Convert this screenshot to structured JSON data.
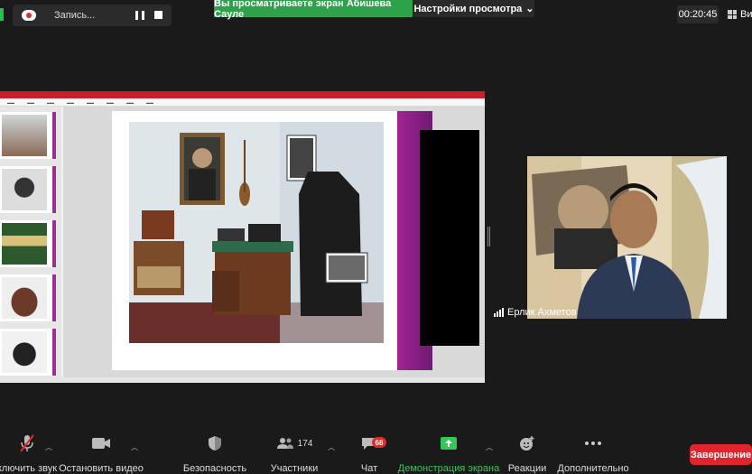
{
  "colors": {
    "accent_green": "#2ea24b",
    "end_red": "#e0252e",
    "badge_red": "#e02b2b",
    "slide_purple": "#a2258f"
  },
  "recording": {
    "label": "Запись...",
    "icons": [
      "record-icon",
      "pause-icon",
      "stop-icon"
    ]
  },
  "banner": {
    "sharing_text": "Вы просматриваете экран Абишева Сауле",
    "view_settings": "Настройки просмотра",
    "chevron": "⌄"
  },
  "timer": "00:20:45",
  "view_button": "Ви",
  "participant": {
    "name": "Ерлик Ахметов"
  },
  "toolbar": {
    "unmute": "ключить звук",
    "stop_video": "Остановить видео",
    "security": "Безопасность",
    "participants": "Участники",
    "participants_count": "174",
    "chat": "Чат",
    "chat_badge": "68",
    "share_screen": "Демонстрация экрана",
    "reactions": "Реакции",
    "more": "Дополнительно",
    "end": "Завершение"
  }
}
